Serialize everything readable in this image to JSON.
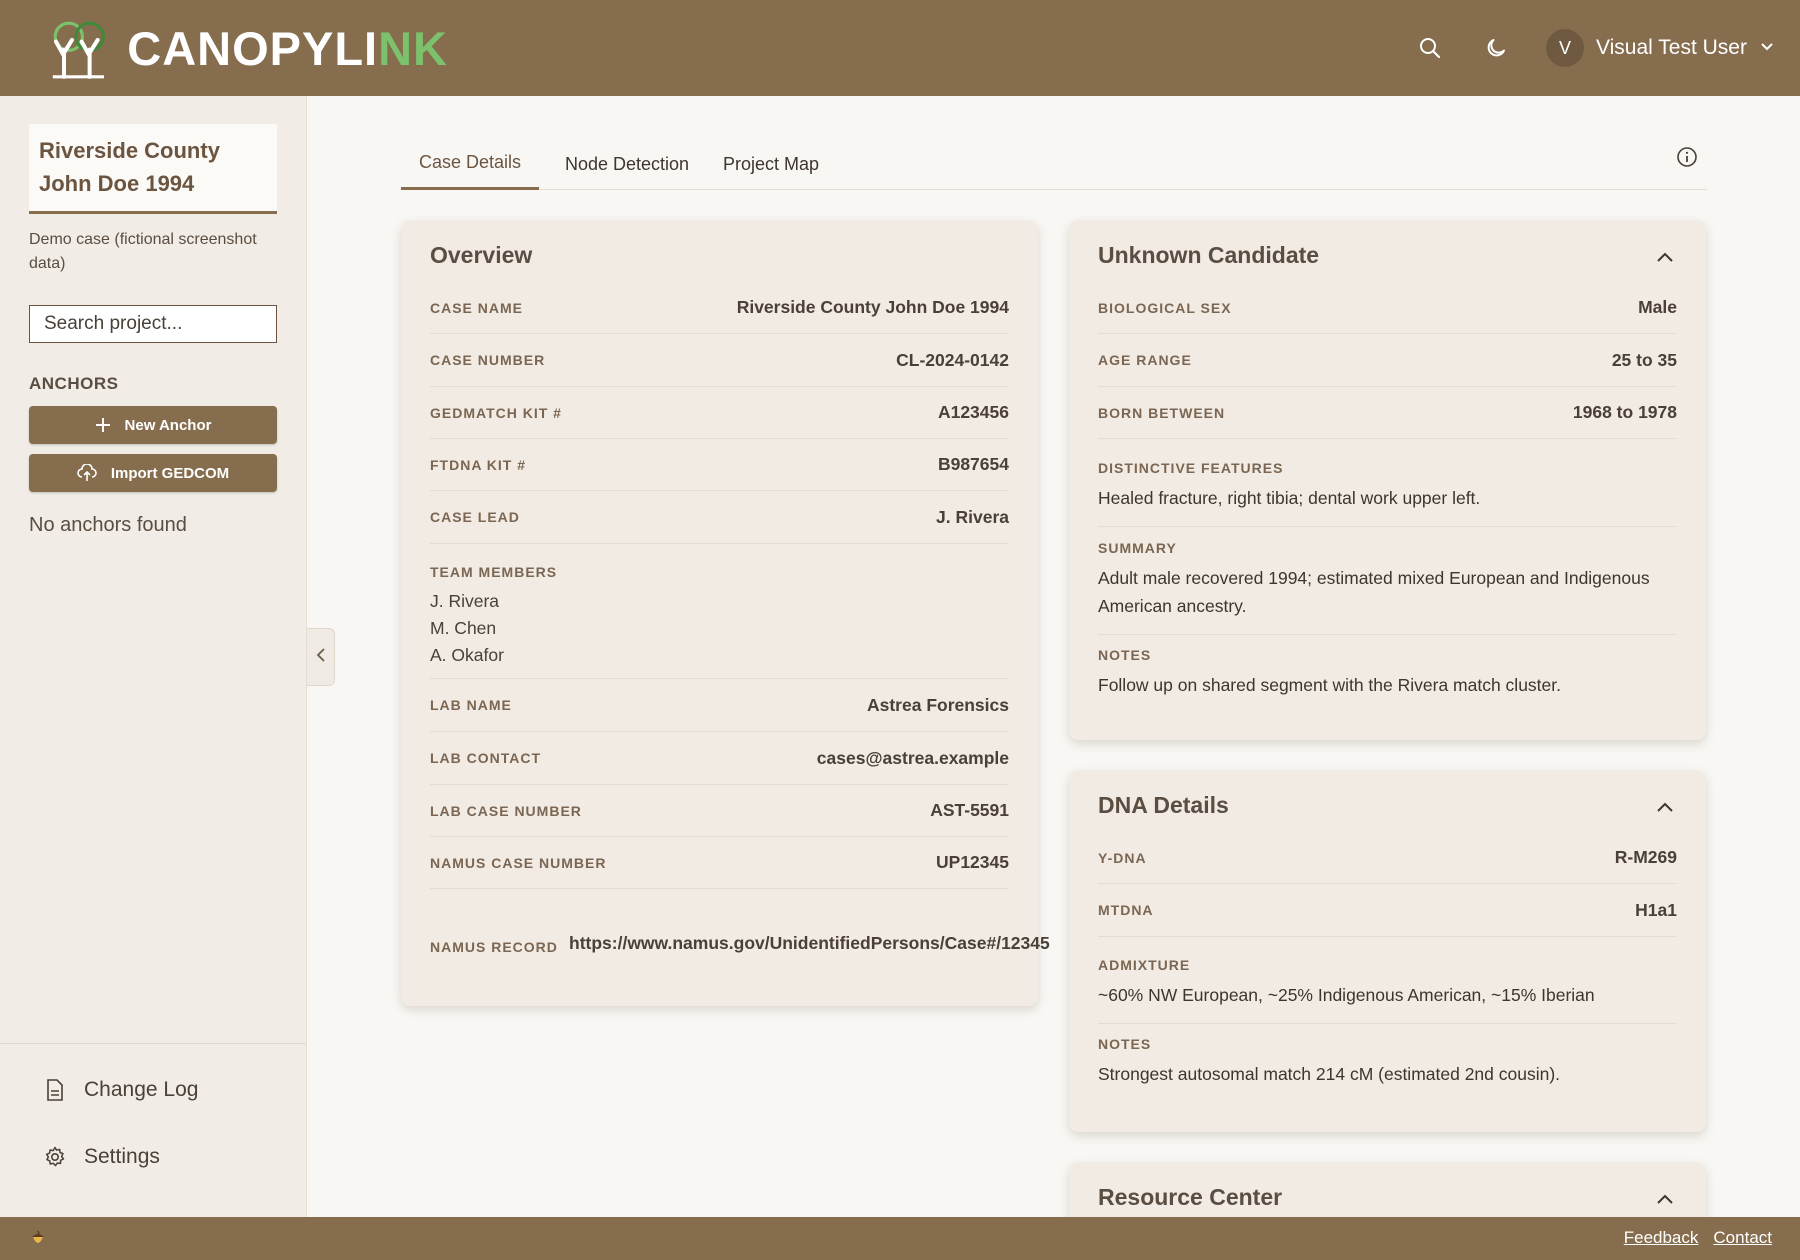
{
  "header": {
    "logo_text_main": "CANOPYLI",
    "logo_text_accent": "NK",
    "user_initial": "V",
    "user_name": "Visual Test User"
  },
  "sidebar": {
    "project_title_line1": "Riverside County",
    "project_title_line2": "John Doe 1994",
    "project_desc": "Demo case (fictional screenshot data)",
    "search_placeholder": "Search project...",
    "anchors_heading": "ANCHORS",
    "new_anchor_label": "New Anchor",
    "import_label": "Import GEDCOM",
    "empty_text": "No anchors found",
    "changelog_label": "Change Log",
    "settings_label": "Settings"
  },
  "tabs": [
    {
      "label": "Case Details",
      "active": true
    },
    {
      "label": "Node Detection",
      "active": false
    },
    {
      "label": "Project Map",
      "active": false
    }
  ],
  "overview": {
    "title": "Overview",
    "case_name_label": "CASE NAME",
    "case_name": "Riverside County John Doe 1994",
    "case_number_label": "CASE NUMBER",
    "case_number": "CL-2024-0142",
    "gedmatch_label": "GEDMATCH KIT #",
    "gedmatch": "A123456",
    "ftdna_label": "FTDNA KIT #",
    "ftdna": "B987654",
    "lead_label": "CASE LEAD",
    "lead": "J. Rivera",
    "team_label": "TEAM MEMBERS",
    "team": [
      "J. Rivera",
      "M. Chen",
      "A. Okafor"
    ],
    "lab_name_label": "LAB NAME",
    "lab_name": "Astrea Forensics",
    "lab_contact_label": "LAB CONTACT",
    "lab_contact": "cases@astrea.example",
    "lab_case_label": "LAB CASE NUMBER",
    "lab_case": "AST-5591",
    "namus_case_label": "NAMUS CASE NUMBER",
    "namus_case": "UP12345",
    "namus_record_label": "NAMUS RECORD",
    "namus_record": "https://www.namus.gov/UnidentifiedPersons/Case#/12345"
  },
  "candidate": {
    "title": "Unknown Candidate",
    "sex_label": "BIOLOGICAL SEX",
    "sex": "Male",
    "age_label": "AGE RANGE",
    "age": "25 to 35",
    "born_label": "BORN BETWEEN",
    "born": "1968 to 1978",
    "features_label": "DISTINCTIVE FEATURES",
    "features": "Healed fracture, right tibia; dental work upper left.",
    "summary_label": "SUMMARY",
    "summary": "Adult male recovered 1994; estimated mixed European and Indigenous American ancestry.",
    "notes_label": "NOTES",
    "notes": "Follow up on shared segment with the Rivera match cluster."
  },
  "dna": {
    "title": "DNA Details",
    "ydna_label": "Y-DNA",
    "ydna": "R-M269",
    "mtdna_label": "MTDNA",
    "mtdna": "H1a1",
    "admixture_label": "ADMIXTURE",
    "admixture": "~60% NW European, ~25% Indigenous American, ~15% Iberian",
    "notes_label": "NOTES",
    "notes": "Strongest autosomal match 214 cM (estimated 2nd cousin)."
  },
  "resource": {
    "title": "Resource Center"
  },
  "footer": {
    "feedback": "Feedback",
    "contact": "Contact"
  },
  "colors": {
    "brand_brown": "#856d4e",
    "accent_green": "#7cc16b",
    "card_bg": "#f1ebe3"
  }
}
